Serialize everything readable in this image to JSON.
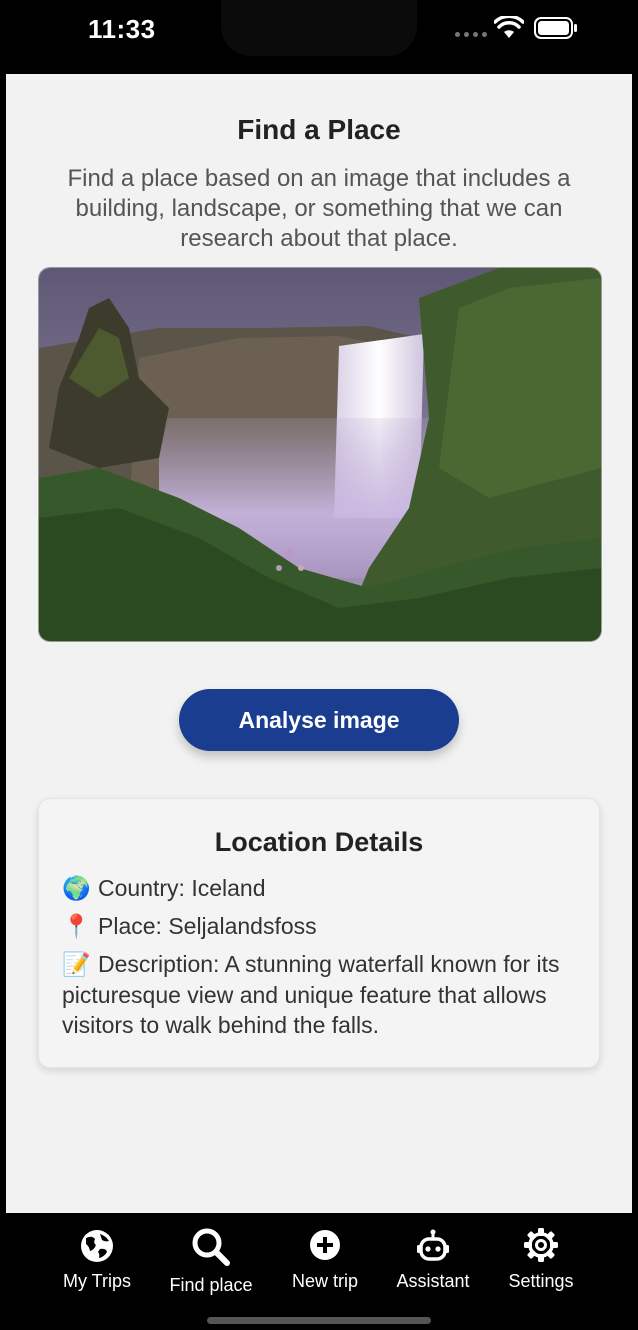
{
  "status_bar": {
    "time": "11:33"
  },
  "page": {
    "title": "Find a Place",
    "subtitle": "Find a place based on an image that includes a building, landscape, or something that we can research about that place."
  },
  "analyse_button_label": "Analyse image",
  "details": {
    "title": "Location Details",
    "country": {
      "emoji": "🌍",
      "text": "Country: Iceland"
    },
    "place": {
      "emoji": "📍",
      "text": "Place: Seljalandsfoss"
    },
    "description": {
      "emoji": "📝",
      "text": "Description: A stunning waterfall known for its picturesque view and unique feature that allows visitors to walk behind the falls."
    }
  },
  "tabs": [
    {
      "label": "My Trips",
      "icon": "globe-icon"
    },
    {
      "label": "Find place",
      "icon": "search-icon"
    },
    {
      "label": "New trip",
      "icon": "plus-circle-icon"
    },
    {
      "label": "Assistant",
      "icon": "robot-icon"
    },
    {
      "label": "Settings",
      "icon": "gear-icon"
    }
  ],
  "colors": {
    "accent": "#1a3d8f",
    "background": "#f2f2f2",
    "tab_bar": "#000000"
  }
}
